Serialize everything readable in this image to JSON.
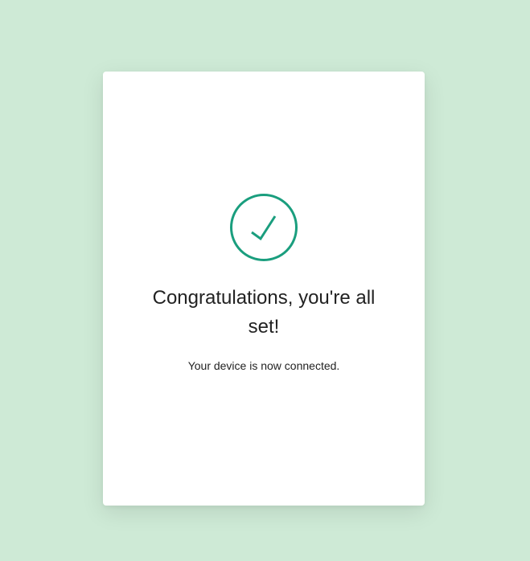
{
  "page": {
    "background_color": "#ceead6",
    "card_color": "#ffffff",
    "accent_color": "#1a9e7e"
  },
  "success": {
    "icon": "check-circle-icon",
    "title": "Congratulations, you're all set!",
    "message": "Your device is now connected."
  }
}
